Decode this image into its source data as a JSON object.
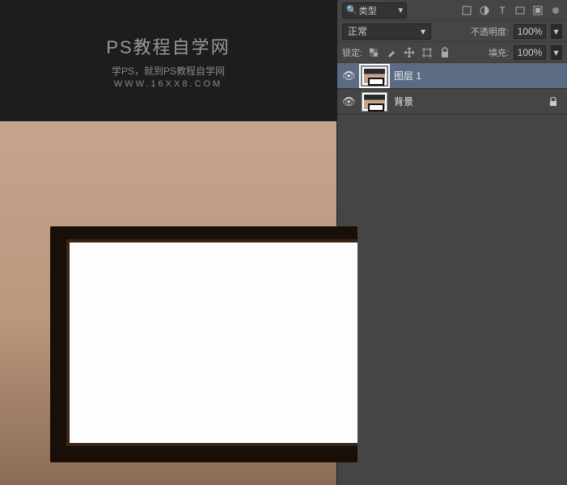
{
  "canvas": {
    "title": "PS教程自学网",
    "sub1": "学PS，就到PS教程自学网",
    "sub2": "WWW.16XX8.COM"
  },
  "filter": {
    "search_label": "类型",
    "arrow": "▾"
  },
  "blend": {
    "mode": "正常",
    "arrow": "▾",
    "opacity_label": "不透明度:",
    "opacity_value": "100%"
  },
  "lock": {
    "label": "锁定:",
    "fill_label": "填充:",
    "fill_value": "100%"
  },
  "layers": [
    {
      "name": "图层 1",
      "visible": true,
      "selected": true,
      "locked": false
    },
    {
      "name": "背景",
      "visible": true,
      "selected": false,
      "locked": true
    }
  ]
}
